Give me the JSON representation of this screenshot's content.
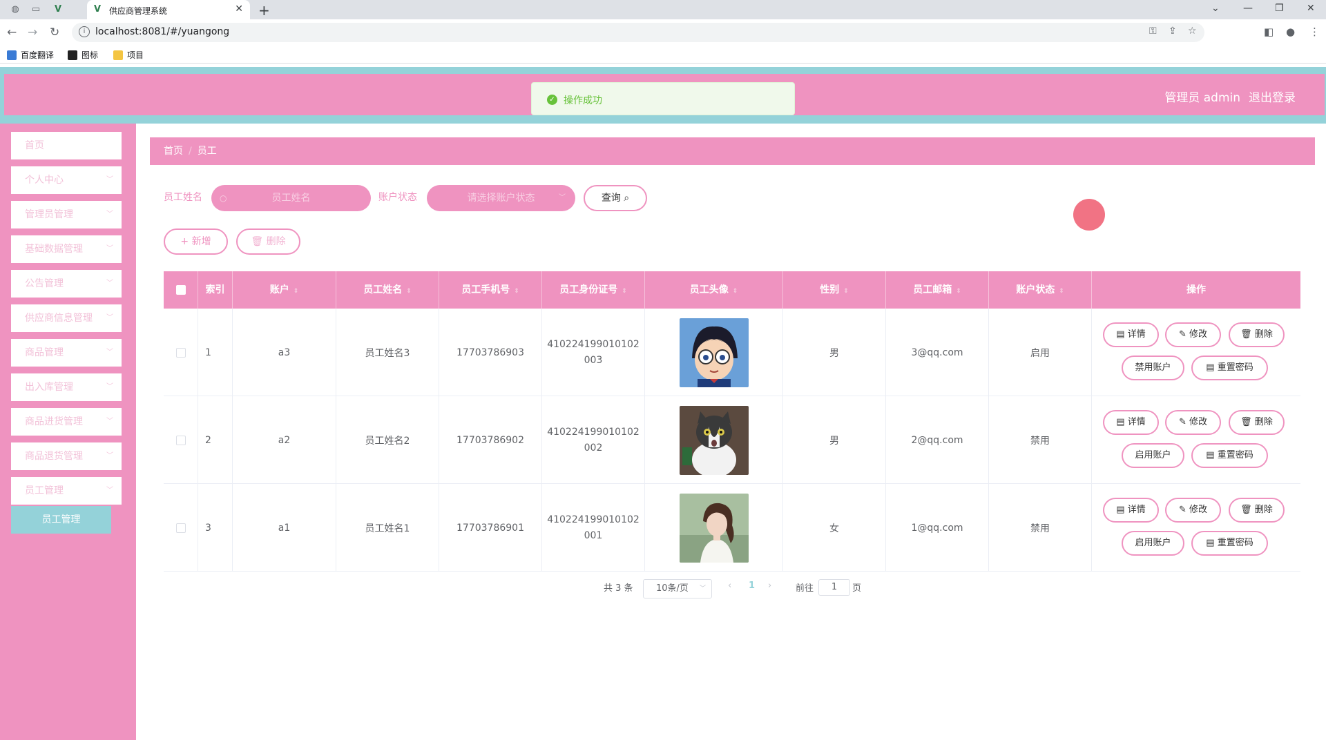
{
  "browser": {
    "tab_title": "供应商管理系统",
    "url": "localhost:8081/#/yuangong",
    "bookmarks": [
      "百度翻译",
      "图标",
      "项目"
    ]
  },
  "header": {
    "user": "管理员 admin",
    "logout": "退出登录"
  },
  "toast": {
    "message": "操作成功"
  },
  "sidebar": {
    "items": [
      "首页",
      "个人中心",
      "管理员管理",
      "基础数据管理",
      "公告管理",
      "供应商信息管理",
      "商品管理",
      "出入库管理",
      "商品进货管理",
      "商品退货管理",
      "员工管理"
    ],
    "sub_active": "员工管理"
  },
  "breadcrumb": {
    "home": "首页",
    "current": "员工"
  },
  "search": {
    "name_label": "员工姓名",
    "name_placeholder": "员工姓名",
    "status_label": "账户状态",
    "status_placeholder": "请选择账户状态",
    "query": "查询"
  },
  "actions": {
    "add": "新增",
    "delete": "删除"
  },
  "table": {
    "columns": [
      "索引",
      "账户",
      "员工姓名",
      "员工手机号",
      "员工身份证号",
      "员工头像",
      "性别",
      "员工邮箱",
      "账户状态",
      "操作"
    ],
    "rows": [
      {
        "index": "1",
        "account": "a3",
        "name": "员工姓名3",
        "phone": "17703786903",
        "id_line1": "410224199010102",
        "id_line2": "003",
        "avatar": "cartoon-boy-glasses",
        "gender": "男",
        "email": "3@qq.com",
        "status": "启用",
        "toggle": "禁用账户"
      },
      {
        "index": "2",
        "account": "a2",
        "name": "员工姓名2",
        "phone": "17703786902",
        "id_line1": "410224199010102",
        "id_line2": "002",
        "avatar": "cat",
        "gender": "男",
        "email": "2@qq.com",
        "status": "禁用",
        "toggle": "启用账户"
      },
      {
        "index": "3",
        "account": "a1",
        "name": "员工姓名1",
        "phone": "17703786901",
        "id_line1": "410224199010102",
        "id_line2": "001",
        "avatar": "girl-ponytail",
        "gender": "女",
        "email": "1@qq.com",
        "status": "禁用",
        "toggle": "启用账户"
      }
    ],
    "row_actions": {
      "detail": "详情",
      "edit": "修改",
      "delete": "删除",
      "reset": "重置密码"
    }
  },
  "pagination": {
    "total": "共 3 条",
    "page_size": "10条/页",
    "current": "1",
    "goto_prefix": "前往",
    "goto_value": "1",
    "goto_suffix": "页"
  },
  "colors": {
    "primary": "#ef93c0",
    "teal": "#94d2d9",
    "success": "#67c23a"
  }
}
